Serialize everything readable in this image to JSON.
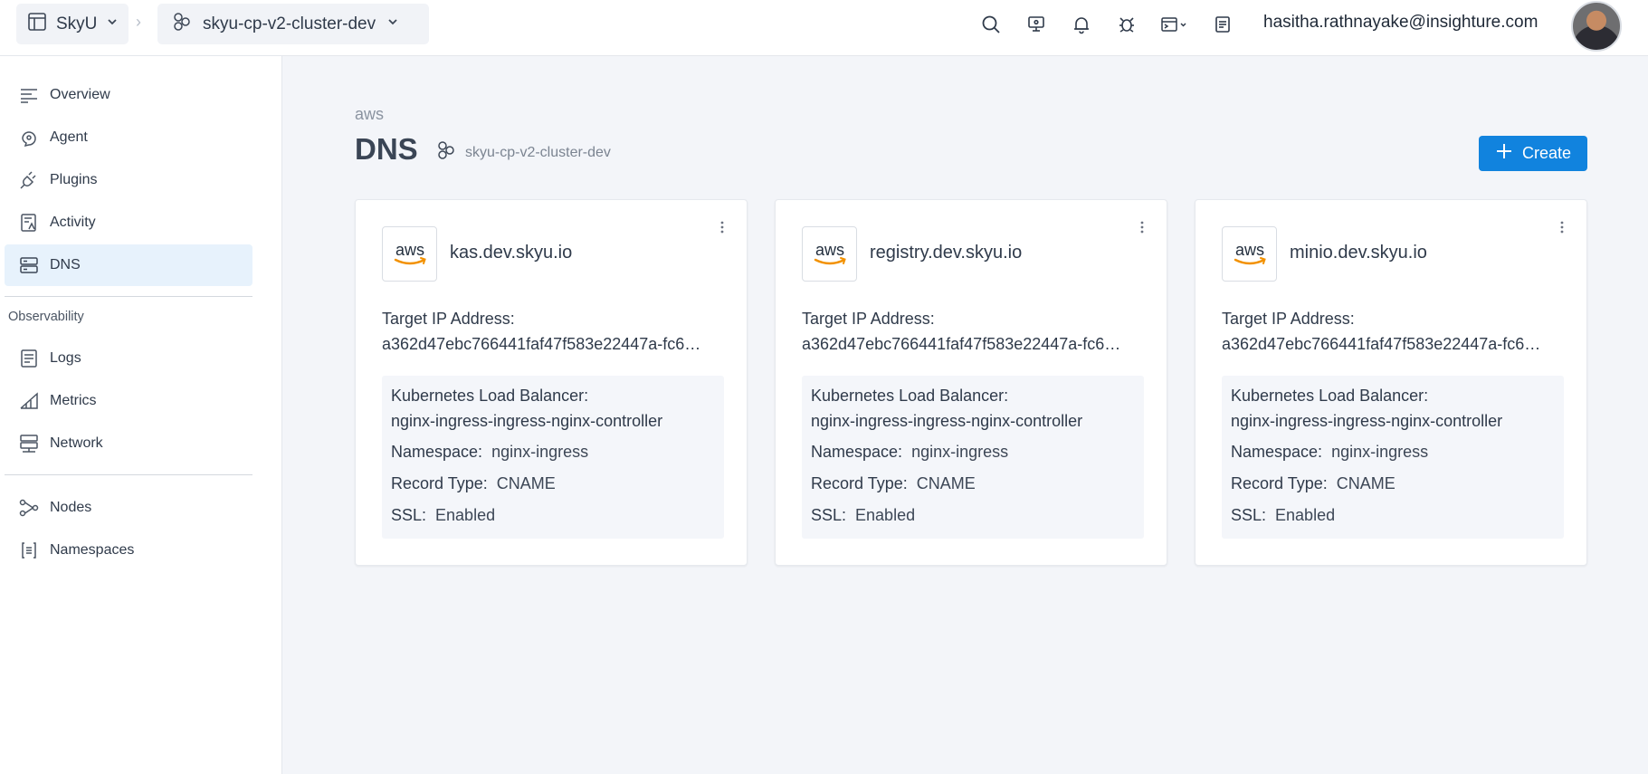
{
  "topbar": {
    "org": "SkyU",
    "cluster": "skyu-cp-v2-cluster-dev",
    "user_email": "hasitha.rathnayake@insighture.com",
    "icons": [
      "search-icon",
      "monitor-icon",
      "bell-icon",
      "bug-icon",
      "terminal-icon",
      "document-icon"
    ]
  },
  "sidebar": {
    "items": [
      {
        "label": "Overview",
        "icon": "lines-icon"
      },
      {
        "label": "Agent",
        "icon": "agent-icon"
      },
      {
        "label": "Plugins",
        "icon": "plug-icon"
      },
      {
        "label": "Activity",
        "icon": "activity-icon"
      },
      {
        "label": "DNS",
        "icon": "dns-icon",
        "active": true
      }
    ],
    "section_label": "Observability",
    "observability": [
      {
        "label": "Logs",
        "icon": "logs-icon"
      },
      {
        "label": "Metrics",
        "icon": "metrics-icon"
      },
      {
        "label": "Network",
        "icon": "network-icon"
      }
    ],
    "resources": [
      {
        "label": "Nodes",
        "icon": "nodes-icon"
      },
      {
        "label": "Namespaces",
        "icon": "namespaces-icon"
      }
    ]
  },
  "main": {
    "provider": "aws",
    "title": "DNS",
    "cluster": "skyu-cp-v2-cluster-dev",
    "create_label": "Create",
    "cards": [
      {
        "logo_text": "aws",
        "host": "kas.dev.skyu.io",
        "target_ip_label": "Target IP Address:",
        "target_ip": "a362d47ebc766441faf47f583e22447a-fc6…",
        "k8s_lb_label": "Kubernetes Load Balancer:",
        "k8s_lb": "nginx-ingress-ingress-nginx-controller",
        "namespace_label": "Namespace:",
        "namespace": "nginx-ingress",
        "record_type_label": "Record Type:",
        "record_type": "CNAME",
        "ssl_label": "SSL:",
        "ssl": "Enabled"
      },
      {
        "logo_text": "aws",
        "host": "registry.dev.skyu.io",
        "target_ip_label": "Target IP Address:",
        "target_ip": "a362d47ebc766441faf47f583e22447a-fc6…",
        "k8s_lb_label": "Kubernetes Load Balancer:",
        "k8s_lb": "nginx-ingress-ingress-nginx-controller",
        "namespace_label": "Namespace:",
        "namespace": "nginx-ingress",
        "record_type_label": "Record Type:",
        "record_type": "CNAME",
        "ssl_label": "SSL:",
        "ssl": "Enabled"
      },
      {
        "logo_text": "aws",
        "host": "minio.dev.skyu.io",
        "target_ip_label": "Target IP Address:",
        "target_ip": "a362d47ebc766441faf47f583e22447a-fc6…",
        "k8s_lb_label": "Kubernetes Load Balancer:",
        "k8s_lb": "nginx-ingress-ingress-nginx-controller",
        "namespace_label": "Namespace:",
        "namespace": "nginx-ingress",
        "record_type_label": "Record Type:",
        "record_type": "CNAME",
        "ssl_label": "SSL:",
        "ssl": "Enabled"
      }
    ]
  },
  "colors": {
    "accent": "#1183de",
    "active_bg": "#e7f2fc",
    "page_bg": "#f3f5f9",
    "aws_orange": "#f29100"
  }
}
